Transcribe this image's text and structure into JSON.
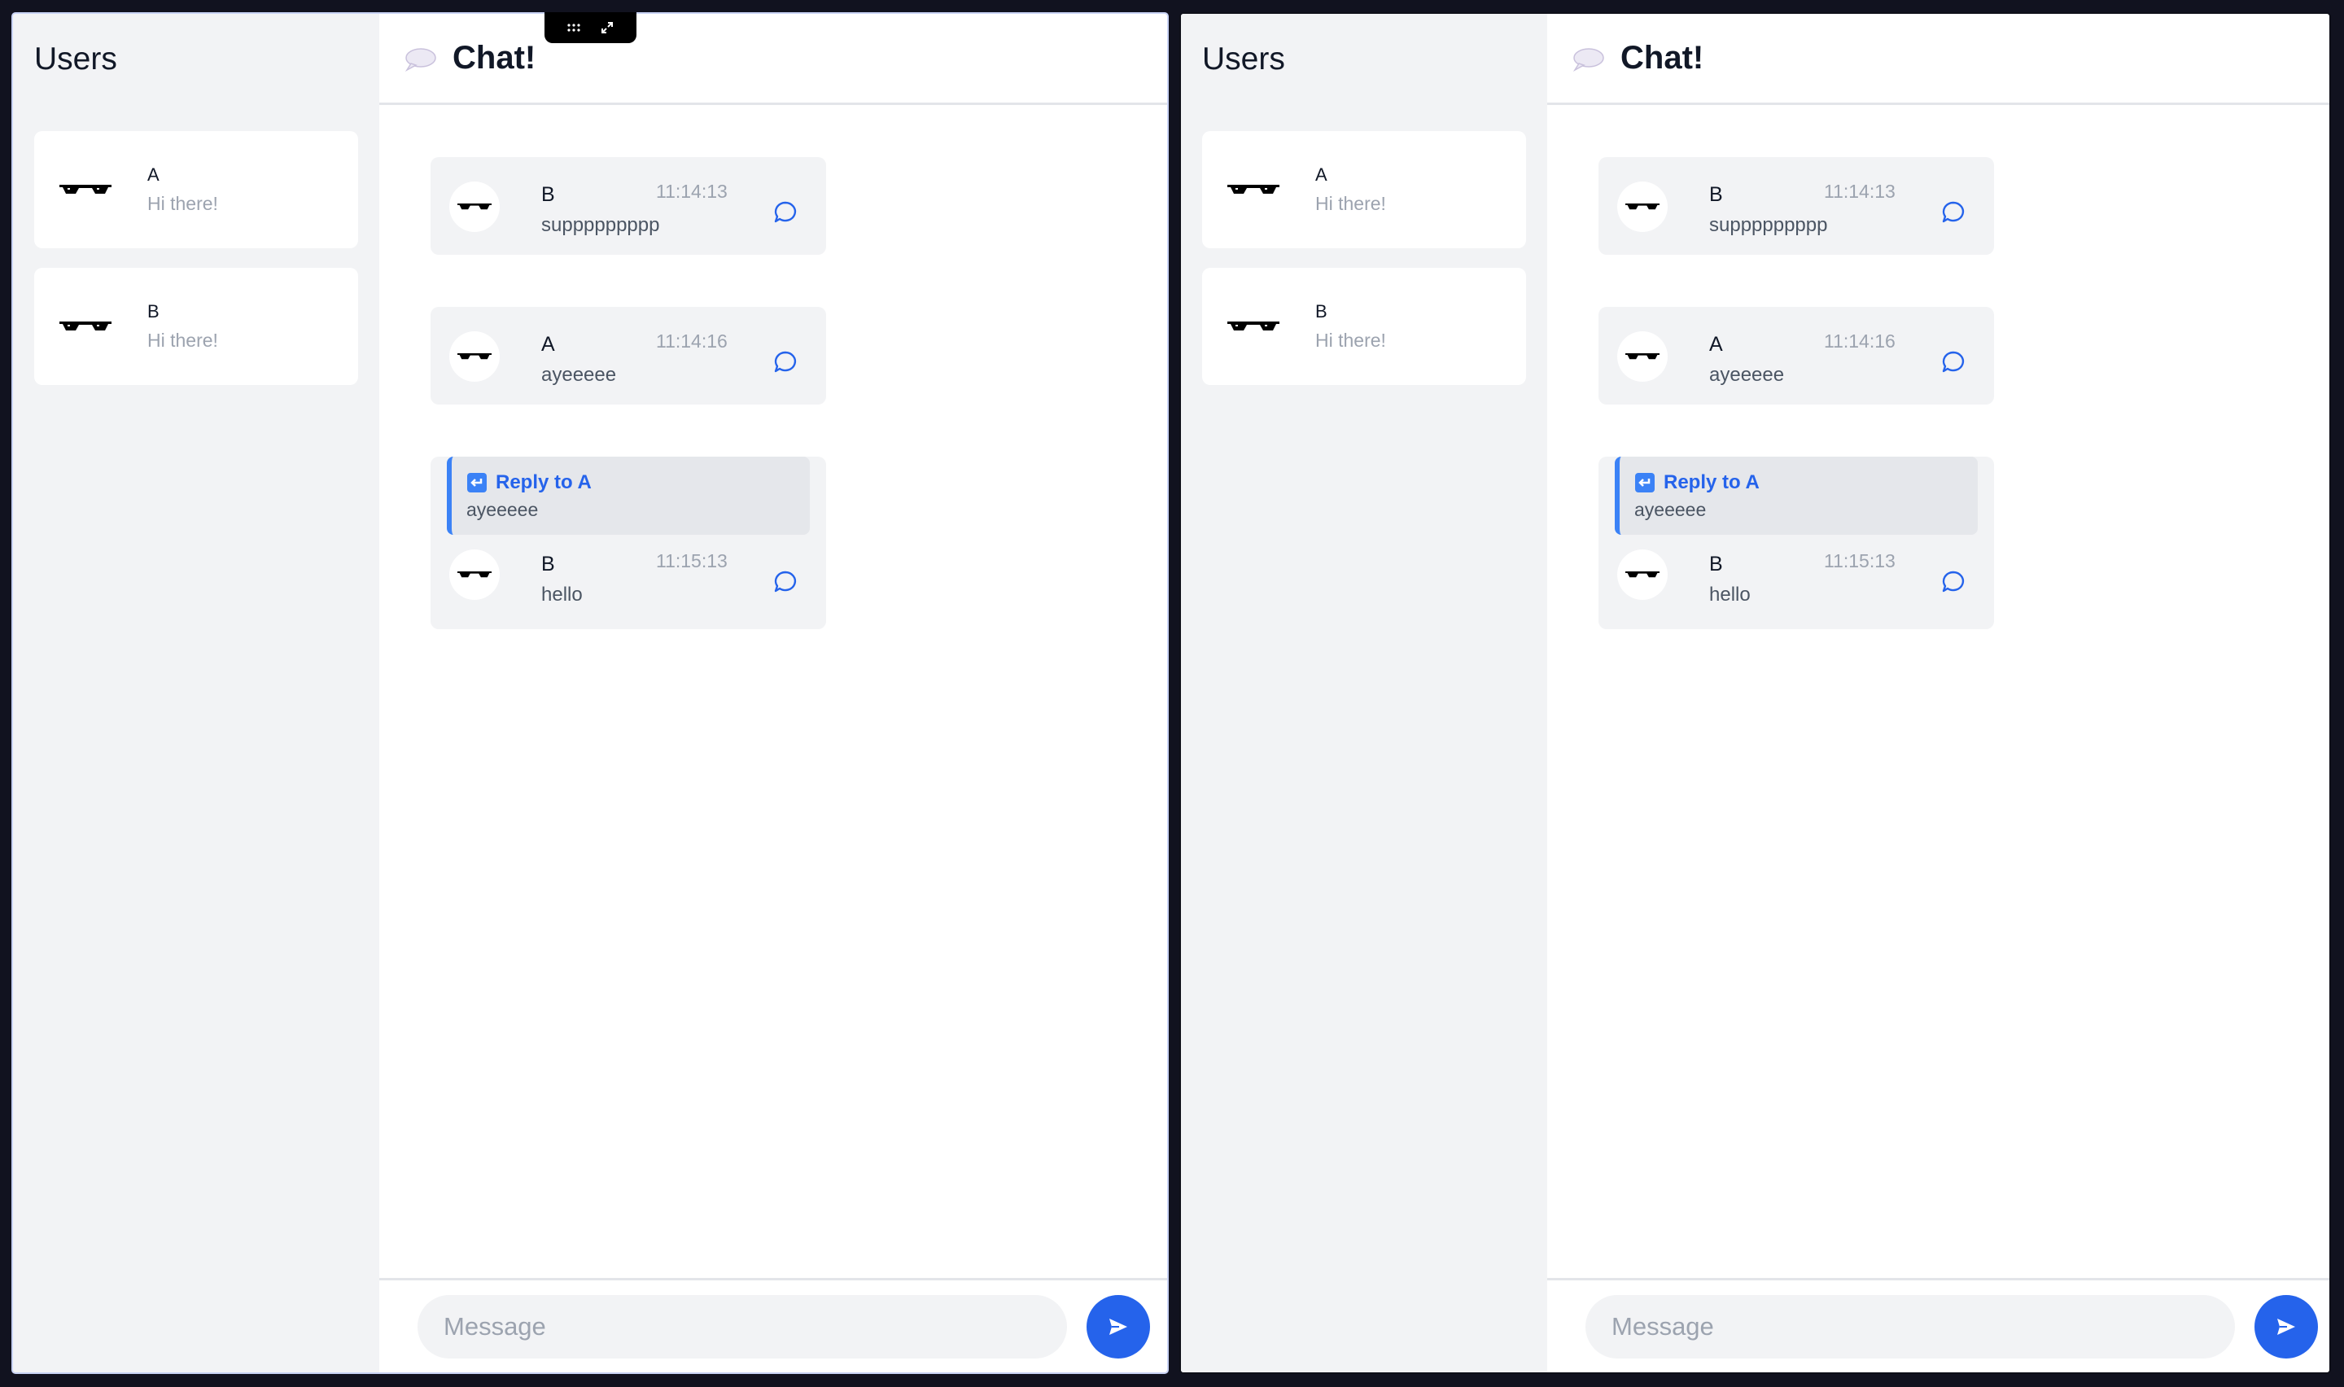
{
  "panels": [
    {
      "sidebar": {
        "title": "Users",
        "users": [
          {
            "name": "A",
            "preview": "Hi there!"
          },
          {
            "name": "B",
            "preview": "Hi there!"
          }
        ]
      },
      "chat": {
        "title": "Chat!",
        "messages": [
          {
            "sender": "B",
            "time": "11:14:13",
            "text": "suppppppppp"
          },
          {
            "sender": "A",
            "time": "11:14:16",
            "text": "ayeeeee"
          },
          {
            "reply_label": "Reply to A",
            "reply_text": "ayeeeee",
            "sender": "B",
            "time": "11:15:13",
            "text": "hello"
          }
        ],
        "composer": {
          "placeholder": "Message"
        }
      }
    },
    {
      "sidebar": {
        "title": "Users",
        "users": [
          {
            "name": "A",
            "preview": "Hi there!"
          },
          {
            "name": "B",
            "preview": "Hi there!"
          }
        ]
      },
      "chat": {
        "title": "Chat!",
        "messages": [
          {
            "sender": "B",
            "time": "11:14:13",
            "text": "suppppppppp"
          },
          {
            "sender": "A",
            "time": "11:14:16",
            "text": "ayeeeee"
          },
          {
            "reply_label": "Reply to A",
            "reply_text": "ayeeeee",
            "sender": "B",
            "time": "11:15:13",
            "text": "hello"
          }
        ],
        "composer": {
          "placeholder": "Message"
        }
      }
    }
  ],
  "toolbar_icons": [
    "drag-handle-icon",
    "expand-icon"
  ],
  "colors": {
    "accent": "#2563eb",
    "sidebar_bg": "#f2f3f5",
    "page_bg": "#11121f",
    "muted_text": "#9ca3af"
  }
}
